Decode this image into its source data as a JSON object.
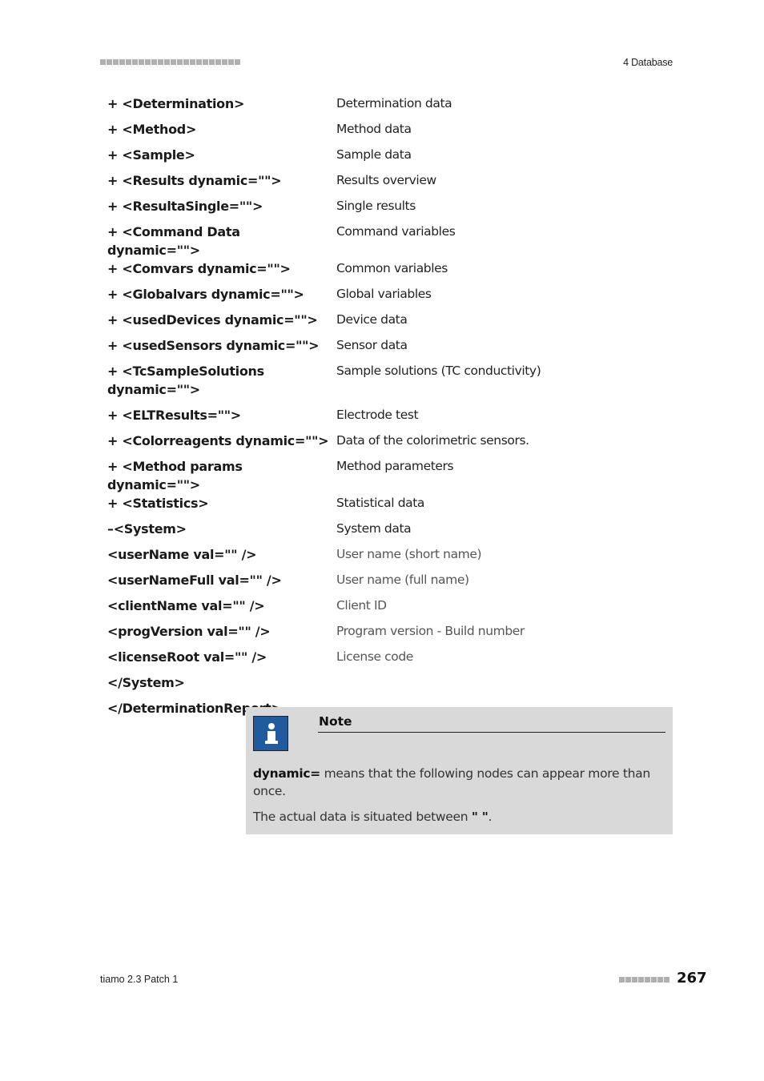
{
  "header": {
    "chapter": "4 Database"
  },
  "rows": [
    {
      "tag": "+ <Determination>",
      "desc": "Determination data"
    },
    {
      "tag": "+ <Method>",
      "desc": "Method data"
    },
    {
      "tag": "+ <Sample>",
      "desc": "Sample data"
    },
    {
      "tag": "+ <Results dynamic=\"\">",
      "desc": "Results overview"
    },
    {
      "tag": "+ <ResultaSingle=\"\">",
      "desc": "Single results"
    },
    {
      "tag": "+ <Command Data dynamic=\"\">",
      "desc": "Command variables"
    },
    {
      "tag": "+ <Comvars dynamic=\"\">",
      "desc": "Common variables"
    },
    {
      "tag": "+ <Globalvars dynamic=\"\">",
      "desc": "Global variables"
    },
    {
      "tag": "+ <usedDevices dynamic=\"\">",
      "desc": "Device data"
    },
    {
      "tag": "+ <usedSensors dynamic=\"\">",
      "desc": "Sensor data"
    },
    {
      "tag": "+ <TcSampleSolutions dynamic=\"\">",
      "desc": "Sample solutions (TC conductivity)"
    },
    {
      "tag": "+ <ELTResults=\"\">",
      "desc": "Electrode test"
    },
    {
      "tag": "+ <Colorreagents dynamic=\"\">",
      "desc": "Data of the colorimetric sensors."
    },
    {
      "tag": "+ <Method params dynamic=\"\">",
      "desc": "Method parameters"
    },
    {
      "tag": "+ <Statistics>",
      "desc": "Statistical data"
    },
    {
      "tag": "–<System>",
      "desc": "System data"
    },
    {
      "tag": "<userName val=\"\" />",
      "desc": "User name (short name)"
    },
    {
      "tag": "<userNameFull val=\"\" />",
      "desc": "User name (full name)"
    },
    {
      "tag": "<clientName val=\"\" />",
      "desc": "Client ID"
    },
    {
      "tag": "<progVersion val=\"\" />",
      "desc": "Program version - Build number"
    },
    {
      "tag": "<licenseRoot val=\"\" />",
      "desc": "License code"
    },
    {
      "tag": "</System>",
      "desc": ""
    },
    {
      "tag": "</DeterminationReport>",
      "desc": ""
    }
  ],
  "note": {
    "icon": "info-icon",
    "title": "Note",
    "para1_bold": "dynamic=",
    "para1_rest": " means that the following nodes can appear more than once.",
    "para2_text": "The actual data is situated between ",
    "para2_bold": "\" \"",
    "para2_end": "."
  },
  "footer": {
    "product": "tiamo 2.3 Patch 1",
    "page_number": "267"
  }
}
